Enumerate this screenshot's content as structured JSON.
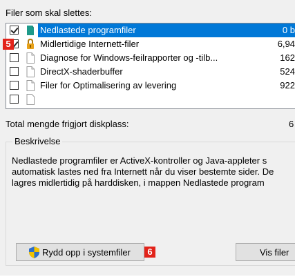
{
  "files_label": "Filer som skal slettes:",
  "items": [
    {
      "label": "Nedlastede programfiler",
      "size": "0 b",
      "checked": true,
      "selected": true,
      "icon": "folder-icon"
    },
    {
      "label": "Midlertidige Internett-filer",
      "size": "6,94",
      "checked": true,
      "selected": false,
      "icon": "lock-icon"
    },
    {
      "label": "Diagnose for Windows-feilrapporter og -tilb...",
      "size": "162",
      "checked": false,
      "selected": false,
      "icon": "file-icon"
    },
    {
      "label": "DirectX-shaderbuffer",
      "size": "524",
      "checked": false,
      "selected": false,
      "icon": "file-icon"
    },
    {
      "label": "Filer for Optimalisering av levering",
      "size": "922",
      "checked": false,
      "selected": false,
      "icon": "file-icon"
    }
  ],
  "total_label": "Total mengde frigjort diskplass:",
  "total_value": "6",
  "description": {
    "title": "Beskrivelse",
    "lines": [
      "Nedlastede programfiler er ActiveX-kontroller og Java-appleter s",
      "automatisk lastes ned fra Internett når du viser bestemte sider. De",
      "lagres midlertidig på harddisken, i mappen Nedlastede program"
    ]
  },
  "buttons": {
    "clean_system": "Rydd opp i systemfiler",
    "view_files": "Vis filer"
  },
  "badges": {
    "list": "5",
    "clean": "6"
  },
  "colors": {
    "selection": "#0078d7",
    "badge": "#e2231a",
    "shield_blue": "#2f6fc9",
    "shield_yellow": "#f2c200"
  }
}
